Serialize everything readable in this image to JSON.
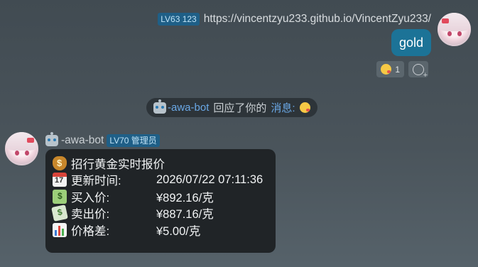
{
  "self_message": {
    "level_badge": "LV63 123",
    "sender": "https://vincentzyu233.github.io/VincentZyu233/",
    "text": "gold",
    "reaction_count": "1"
  },
  "notice": {
    "bot_name": "-awa-bot",
    "middle_text": "回应了你的",
    "link_text": "消息:"
  },
  "bot_message": {
    "bot_name": "-awa-bot",
    "level_badge": "LV70 管理员",
    "title": "招行黄金实时报价",
    "rows": [
      {
        "label": "更新时间:",
        "value": "2026/07/22 07:11:36",
        "icon": "calendar-icon"
      },
      {
        "label": "买入价:",
        "value": "¥892.16/克",
        "icon": "dollar-banknote-icon"
      },
      {
        "label": "卖出价:",
        "value": "¥887.16/克",
        "icon": "money-with-wings-icon"
      },
      {
        "label": "价格差:",
        "value": "¥5.00/克",
        "icon": "bar-chart-icon"
      }
    ],
    "title_icon": "money-bag-icon"
  },
  "colors": {
    "self_bubble": "#1c7397",
    "bot_bubble": "#202427",
    "link": "#6aa8e6",
    "badge": "#1f5f87"
  }
}
